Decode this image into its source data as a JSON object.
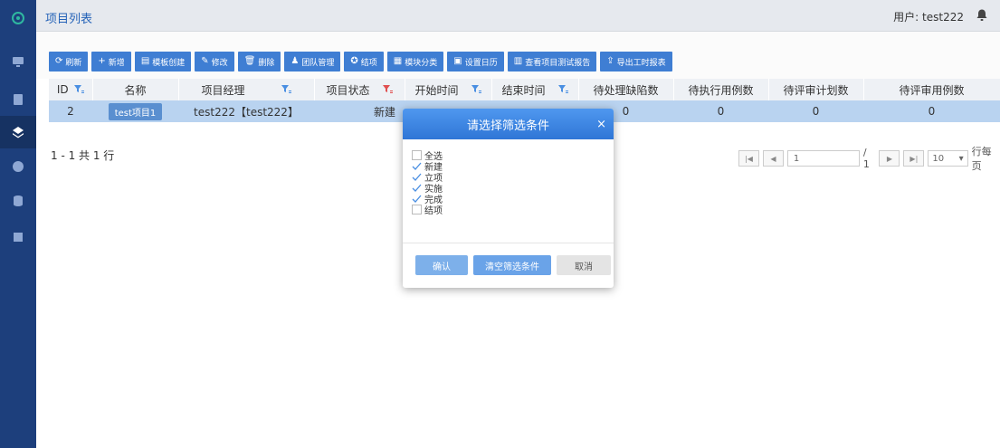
{
  "header": {
    "title": "项目列表",
    "user_label": "用户:",
    "user_name": "test222"
  },
  "toolbar": {
    "buttons": [
      {
        "icon": "refresh-icon",
        "glyph": "⟳",
        "label": "刷新"
      },
      {
        "icon": "plus-icon",
        "glyph": "+",
        "label": "新增"
      },
      {
        "icon": "template-icon",
        "glyph": "▤",
        "label": "模板创建"
      },
      {
        "icon": "edit-icon",
        "glyph": "✎",
        "label": "修改"
      },
      {
        "icon": "trash-icon",
        "glyph": "🗑",
        "label": "删除"
      },
      {
        "icon": "team-icon",
        "glyph": "♟",
        "label": "团队管理"
      },
      {
        "icon": "settle-icon",
        "glyph": "✪",
        "label": "结项"
      },
      {
        "icon": "grid-icon",
        "glyph": "▦",
        "label": "模块分类"
      },
      {
        "icon": "calendar-icon",
        "glyph": "▣",
        "label": "设置日历"
      },
      {
        "icon": "bar-chart-icon",
        "glyph": "▥",
        "label": "查看项目测试报告"
      },
      {
        "icon": "export-icon",
        "glyph": "⇪",
        "label": "导出工时报表"
      }
    ]
  },
  "table": {
    "columns": [
      "ID",
      "名称",
      "项目经理",
      "项目状态",
      "开始时间",
      "结束时间",
      "待处理缺陷数",
      "待执行用例数",
      "待评审计划数",
      "待评审用例数"
    ],
    "rows": [
      {
        "id": "2",
        "name": "test项目1",
        "manager": "test222【test222】",
        "status": "新建",
        "start": "",
        "end": "",
        "defects": "0",
        "cases_exec": "0",
        "plans_review": "0",
        "cases_review": "0"
      }
    ]
  },
  "footer": {
    "record_info": "1 - 1 共 1 行"
  },
  "pager": {
    "current_page": "1",
    "total_pages": "/ 1",
    "page_size": "10",
    "page_size_label": "行每页"
  },
  "dialog": {
    "title": "请选择筛选条件",
    "close": "×",
    "options": [
      {
        "label": "全选",
        "checked": false
      },
      {
        "label": "新建",
        "checked": true
      },
      {
        "label": "立项",
        "checked": true
      },
      {
        "label": "实施",
        "checked": true
      },
      {
        "label": "完成",
        "checked": true
      },
      {
        "label": "结项",
        "checked": false
      }
    ],
    "confirm_label": "确认",
    "clear_label": "清空筛选条件",
    "cancel_label": "取消"
  },
  "colors": {
    "sidebar_bg": "#1d3f7c",
    "accent": "#3f7ed3",
    "selected_row": "#b9d3f0",
    "filter_active": "#e05050",
    "filter_normal": "#4a8fe2"
  }
}
